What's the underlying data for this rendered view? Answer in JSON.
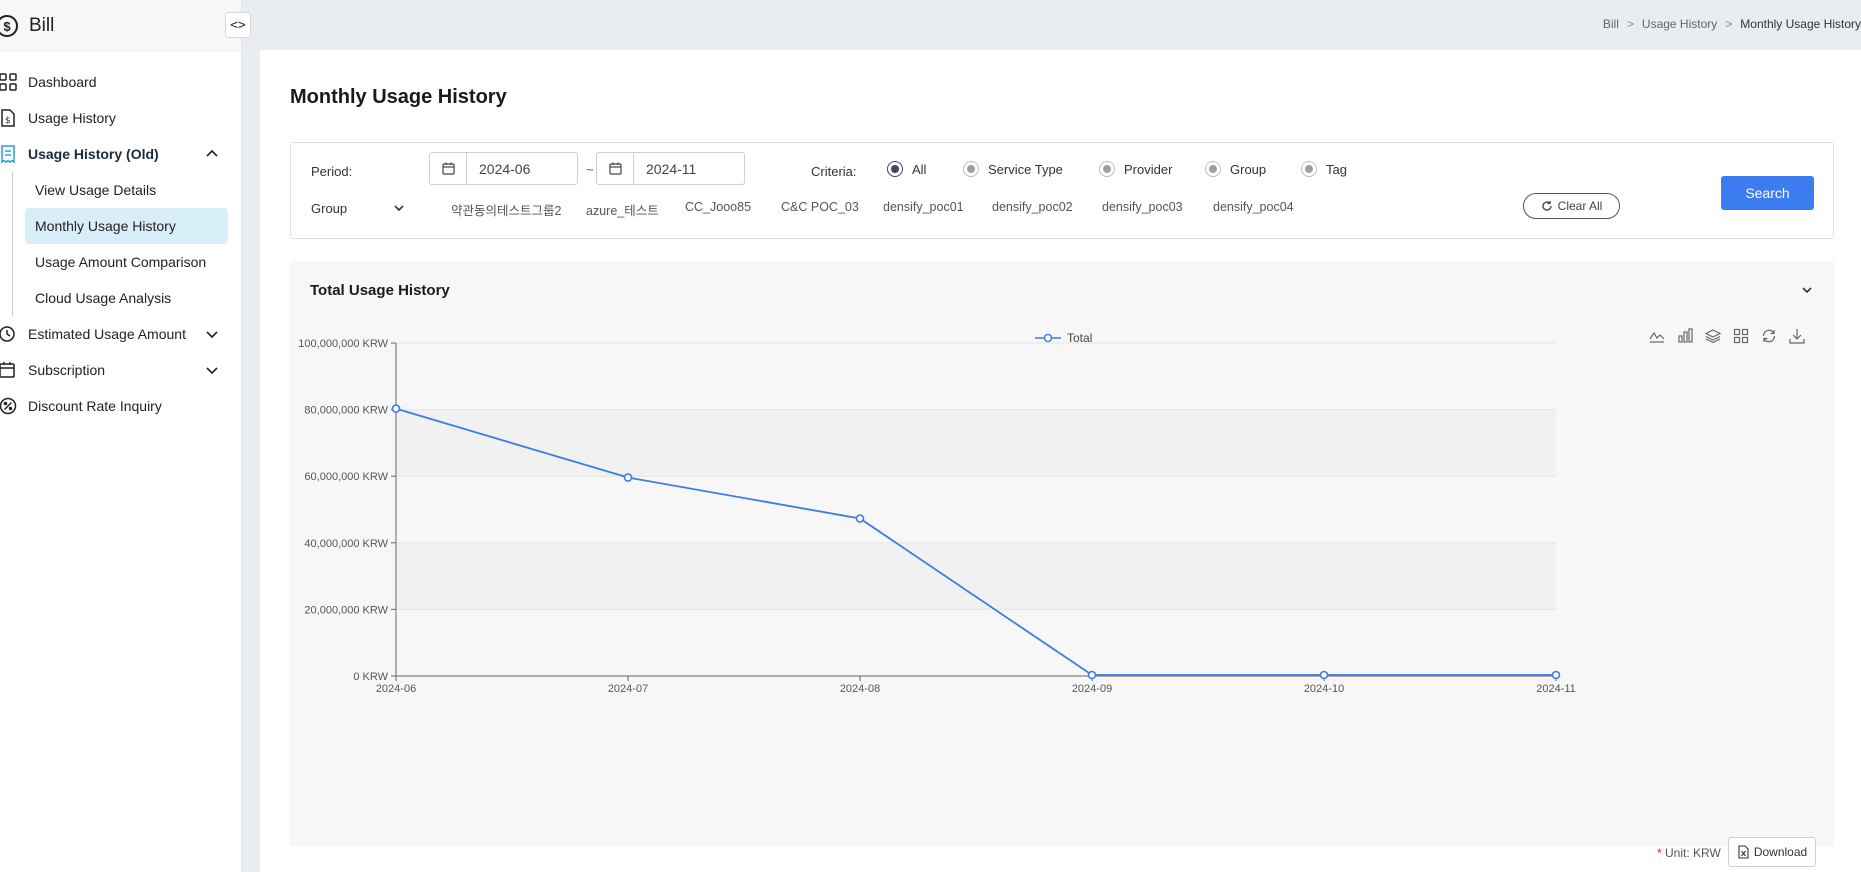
{
  "app": {
    "title": "Bill",
    "logo": "$"
  },
  "sidebar": {
    "toggle_label": "<>",
    "items": [
      {
        "label": "Dashboard",
        "icon": "dashboard-icon"
      },
      {
        "label": "Usage History",
        "icon": "document-dollar-icon"
      },
      {
        "label": "Usage History (Old)",
        "icon": "receipt-icon",
        "expanded": true,
        "children": [
          {
            "label": "View Usage Details"
          },
          {
            "label": "Monthly Usage History",
            "selected": true
          },
          {
            "label": "Usage Amount Comparison"
          },
          {
            "label": "Cloud Usage Analysis"
          }
        ]
      },
      {
        "label": "Estimated Usage Amount",
        "icon": "clock-dollar-icon"
      },
      {
        "label": "Subscription",
        "icon": "calendar-dollar-icon"
      },
      {
        "label": "Discount Rate Inquiry",
        "icon": "percent-icon"
      }
    ]
  },
  "breadcrumb": {
    "items": [
      "Bill",
      "Usage History",
      "Monthly Usage History"
    ],
    "separator": ">"
  },
  "page": {
    "title": "Monthly Usage History"
  },
  "filter": {
    "period_label": "Period:",
    "start": "2024-06",
    "end": "2024-11",
    "range_sep": "~",
    "criteria_label": "Criteria:",
    "criteria_options": [
      "All",
      "Service Type",
      "Provider",
      "Group",
      "Tag"
    ],
    "criteria_selected": "All",
    "group_select": "Group",
    "group_tags": [
      "약관동의테스트그룹2",
      "azure_테스트",
      "CC_Jooo85",
      "C&C POC_03",
      "densify_poc01",
      "densify_poc02",
      "densify_poc03",
      "densify_poc04"
    ],
    "clear_label": "Clear All",
    "search_label": "Search"
  },
  "chart_panel": {
    "title": "Total Usage History"
  },
  "chart_data": {
    "type": "line",
    "title": "",
    "xlabel": "",
    "ylabel": "",
    "categories": [
      "2024-06",
      "2024-07",
      "2024-08",
      "2024-09",
      "2024-10",
      "2024-11"
    ],
    "series": [
      {
        "name": "Total",
        "values": [
          80300000,
          59600000,
          47300000,
          300000,
          300000,
          300000
        ],
        "color": "#3d7be5"
      }
    ],
    "yticks": [
      "0 KRW",
      "20,000,000 KRW",
      "40,000,000 KRW",
      "60,000,000 KRW",
      "80,000,000 KRW",
      "100,000,000 KRW"
    ],
    "ylim": [
      0,
      100000000
    ],
    "grid": true,
    "legend": "top-center",
    "toolbox": [
      "line-chart-icon",
      "bar-chart-icon",
      "stack-icon",
      "tiled-icon",
      "refresh-icon",
      "save-image-icon"
    ]
  },
  "footer": {
    "unit_star": "*",
    "unit_label": "Unit: KRW",
    "download_label": "Download"
  },
  "colors": {
    "accent": "#3d7bf0",
    "selected_bg": "#d8eef8",
    "line": "#3d7be5"
  }
}
